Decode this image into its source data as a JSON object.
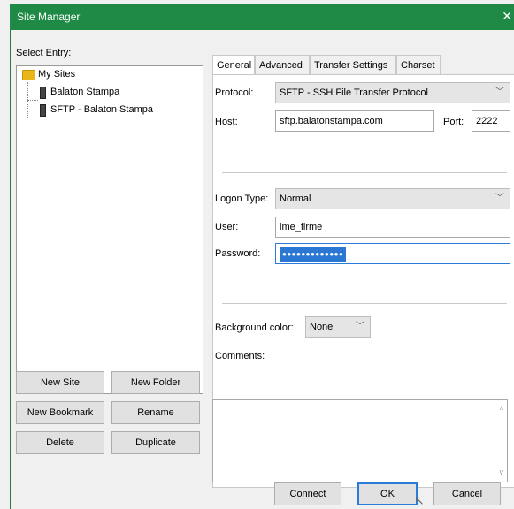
{
  "window": {
    "title": "Site Manager",
    "close_glyph": "✕"
  },
  "tree": {
    "label": "Select Entry:",
    "root": "My Sites",
    "items": [
      "Balaton Stampa",
      "SFTP - Balaton Stampa"
    ]
  },
  "left_buttons": {
    "new_site": "New Site",
    "new_folder": "New Folder",
    "new_bookmark": "New Bookmark",
    "rename": "Rename",
    "delete": "Delete",
    "duplicate": "Duplicate"
  },
  "tabs": [
    "General",
    "Advanced",
    "Transfer Settings",
    "Charset"
  ],
  "general": {
    "protocol_label": "Protocol:",
    "protocol_value": "SFTP - SSH File Transfer Protocol",
    "host_label": "Host:",
    "host_value": "sftp.balatonstampa.com",
    "port_label": "Port:",
    "port_value": "2222",
    "logon_label": "Logon Type:",
    "logon_value": "Normal",
    "user_label": "User:",
    "user_value": "ime_firme",
    "password_label": "Password:",
    "password_mask": "●●●●●●●●●●●●●",
    "bg_label": "Background color:",
    "bg_value": "None",
    "comments_label": "Comments:"
  },
  "bottom_buttons": {
    "connect": "Connect",
    "ok": "OK",
    "cancel": "Cancel"
  },
  "icons": {
    "chevron": "﹀",
    "scroll_up": "^",
    "scroll_down": "v",
    "cursor": "↖"
  },
  "colors": {
    "titlebar": "#1e8a45",
    "focus": "#2b7bd8"
  }
}
